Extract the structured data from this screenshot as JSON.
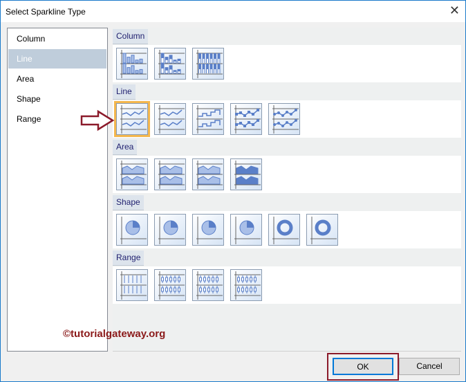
{
  "dialog": {
    "title": "Select Sparkline Type",
    "close_icon": "close-icon"
  },
  "categories": [
    {
      "label": "Column"
    },
    {
      "label": "Line",
      "selected": true
    },
    {
      "label": "Area"
    },
    {
      "label": "Shape"
    },
    {
      "label": "Range"
    }
  ],
  "sections": [
    {
      "label": "Column",
      "icons": [
        "column",
        "column-marked",
        "column-winloss"
      ]
    },
    {
      "label": "Line",
      "icons": [
        "line",
        "line-smooth",
        "line-step",
        "line-markers",
        "line-smooth-markers"
      ],
      "selected_index": 0
    },
    {
      "label": "Area",
      "icons": [
        "area",
        "area-smooth",
        "area-band",
        "area-filled"
      ]
    },
    {
      "label": "Shape",
      "icons": [
        "pie",
        "pie-exploded",
        "pie-3d",
        "pie-3d-exploded",
        "donut",
        "donut-exploded"
      ]
    },
    {
      "label": "Range",
      "icons": [
        "range-hl",
        "range-hlc",
        "range-ohlc",
        "range-box"
      ]
    }
  ],
  "buttons": {
    "ok": "OK",
    "cancel": "Cancel"
  },
  "watermark": "©tutorialgateway.org",
  "colors": {
    "accent": "#0078d7",
    "selection": "#f4b74d",
    "icon": "#5a7fc8",
    "annotation": "#8b1a2a"
  }
}
